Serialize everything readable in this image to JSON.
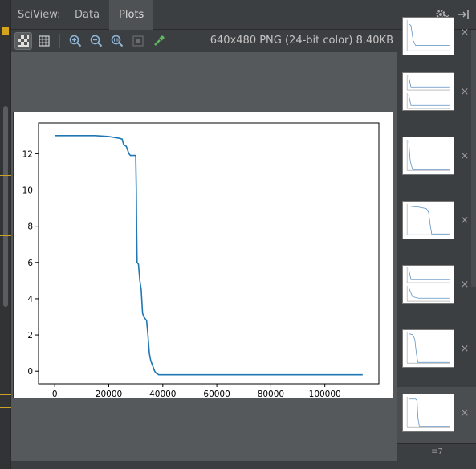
{
  "header": {
    "title": "SciView:",
    "tabs": [
      {
        "label": "Data",
        "active": false
      },
      {
        "label": "Plots",
        "active": true
      }
    ],
    "settings_icon": "gear-icon",
    "hide_icon": "hide-panel-icon"
  },
  "toolbar": {
    "buttons": [
      "checkerboard-background-icon",
      "grid-background-icon",
      "zoom-in-icon",
      "zoom-out-icon",
      "actual-size-icon",
      "fit-to-window-icon",
      "color-picker-icon"
    ],
    "image_info": "640x480 PNG (24-bit color) 8.40KB"
  },
  "colors": {
    "panel_bg": "#3c3f41",
    "canvas_bg": "#55595c",
    "plot_line": "#1f77b4",
    "accent": "#d6a41c"
  },
  "chart_data": {
    "type": "line",
    "title": "",
    "xlabel": "",
    "ylabel": "",
    "xlim": [
      -6000,
      120000
    ],
    "ylim": [
      -0.7,
      13.7
    ],
    "xticks": [
      0,
      20000,
      40000,
      60000,
      80000,
      100000
    ],
    "xtick_labels": [
      "0",
      "20000",
      "40000",
      "60000",
      "80000",
      "100000"
    ],
    "yticks": [
      0,
      2,
      4,
      6,
      8,
      10,
      12
    ],
    "ytick_labels": [
      "0",
      "2",
      "4",
      "6",
      "8",
      "10",
      "12"
    ],
    "grid": false,
    "series": [
      {
        "x": [
          0,
          5000,
          10000,
          15000,
          20000,
          24000,
          25000,
          25500,
          26500,
          27000,
          27500,
          28000,
          29000,
          30000,
          30200,
          30300,
          30500,
          31000,
          31500,
          32000,
          32500,
          33000,
          33500,
          34000,
          34500,
          35000,
          35500,
          36000,
          36500,
          37000,
          37500,
          38000,
          38500,
          39000,
          40000,
          60000,
          80000,
          100000,
          114000
        ],
        "y": [
          13.0,
          13.0,
          13.0,
          13.0,
          12.95,
          12.85,
          12.8,
          12.5,
          12.4,
          12.2,
          12.0,
          11.9,
          11.9,
          11.9,
          10.0,
          8.0,
          6.0,
          5.9,
          5.0,
          4.5,
          3.2,
          3.0,
          2.9,
          2.8,
          2.0,
          1.0,
          0.6,
          0.4,
          0.2,
          0.0,
          -0.1,
          -0.15,
          -0.2,
          -0.2,
          -0.2,
          -0.2,
          -0.2,
          -0.2,
          -0.2
        ]
      }
    ]
  },
  "thumbnails": {
    "items": [
      {
        "kind": "step-two-panel",
        "close": "×"
      },
      {
        "kind": "two-panel",
        "close": "×"
      },
      {
        "kind": "single-decay",
        "close": "×"
      },
      {
        "kind": "step-late",
        "close": "×"
      },
      {
        "kind": "two-panel-decay",
        "close": "×"
      },
      {
        "kind": "step-mid",
        "close": "×"
      },
      {
        "kind": "step-main",
        "close": "×"
      }
    ],
    "footer": "≡7"
  }
}
